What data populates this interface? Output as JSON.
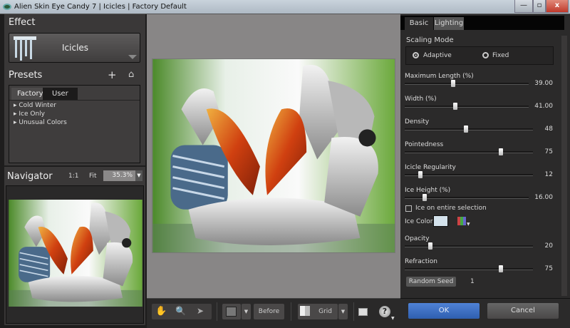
{
  "window": {
    "title": "Alien Skin Eye Candy 7 | Icicles | Factory Default",
    "minimize": "—",
    "maximize": "▫",
    "close": "x"
  },
  "effect": {
    "heading": "Effect",
    "name": "Icicles"
  },
  "presets": {
    "heading": "Presets",
    "add": "+",
    "home": "⌂",
    "tabs": [
      "Factory",
      "User"
    ],
    "active_tab": "Factory",
    "items": [
      "Cold Winter",
      "Ice Only",
      "Unusual Colors"
    ]
  },
  "navigator": {
    "heading": "Navigator",
    "one_to_one": "1:1",
    "fit": "Fit",
    "zoom": "35.3%"
  },
  "toolbar": {
    "before": "Before",
    "grid": "Grid",
    "help": "?"
  },
  "settings": {
    "tabs": [
      "Basic",
      "Lighting"
    ],
    "active_tab": "Basic",
    "scaling_mode": {
      "label": "Scaling Mode",
      "options": [
        "Adaptive",
        "Fixed"
      ],
      "selected": "Adaptive"
    },
    "sliders": [
      {
        "label": "Maximum Length (%)",
        "value": "39.00",
        "fraction": 0.39
      },
      {
        "label": "Width (%)",
        "value": "41.00",
        "fraction": 0.41
      },
      {
        "label": "Density",
        "value": "48",
        "fraction": 0.48
      },
      {
        "label": "Pointedness",
        "value": "75",
        "fraction": 0.75
      },
      {
        "label": "Icicle Regularity",
        "value": "12",
        "fraction": 0.12
      },
      {
        "label": "Ice Height (%)",
        "value": "16.00",
        "fraction": 0.16
      },
      {
        "label": "Opacity",
        "value": "20",
        "fraction": 0.2
      },
      {
        "label": "Refraction",
        "value": "75",
        "fraction": 0.75
      }
    ],
    "ice_on_entire_selection": {
      "label": "Ice on entire selection",
      "checked": false
    },
    "ice_color": {
      "label": "Ice Color",
      "color": "#d4e2ec"
    },
    "random_seed": {
      "label": "Random Seed",
      "value": "1"
    }
  },
  "actions": {
    "ok": "OK",
    "cancel": "Cancel"
  },
  "colors": {
    "ok_button": "#3d6fc4",
    "panel": "#3a3838"
  }
}
